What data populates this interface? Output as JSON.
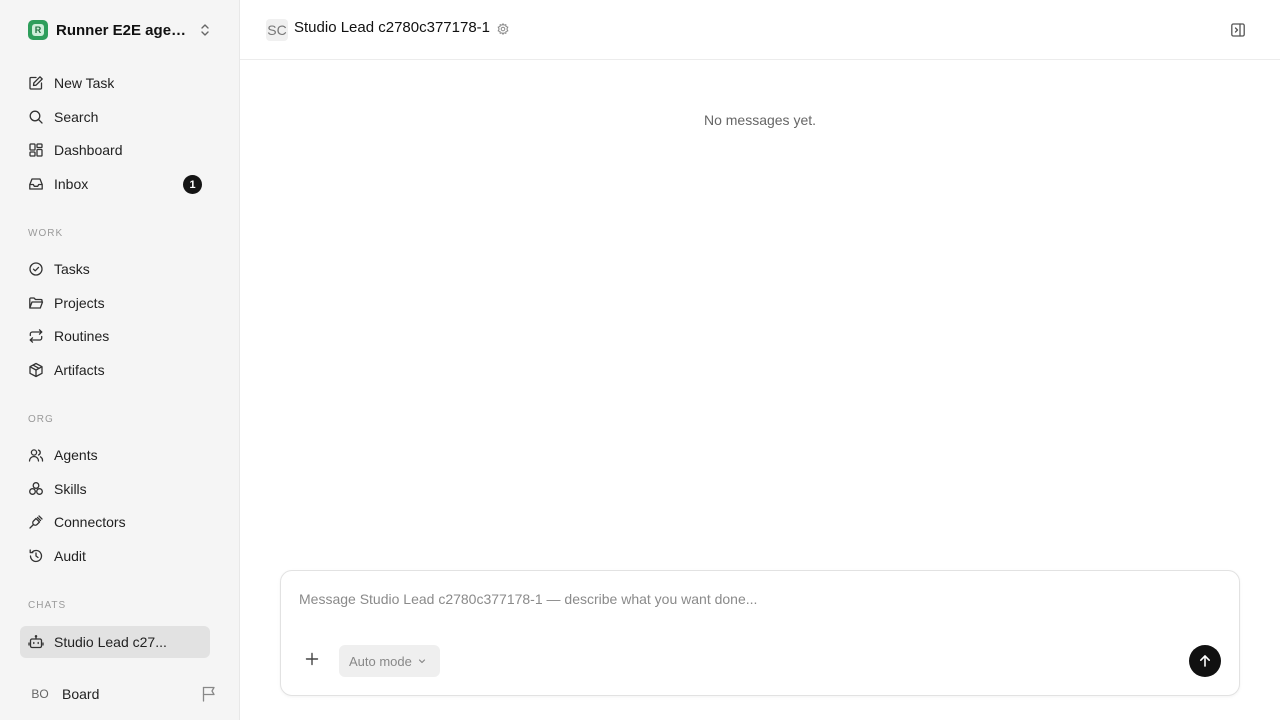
{
  "workspace": {
    "name": "Runner E2E agen...",
    "logo_letter": "R"
  },
  "nav": {
    "new_task": "New Task",
    "search": "Search",
    "dashboard": "Dashboard",
    "inbox": "Inbox",
    "inbox_count": "1"
  },
  "sections": {
    "work": "WORK",
    "org": "ORG",
    "chats": "CHATS"
  },
  "work_items": {
    "tasks": "Tasks",
    "projects": "Projects",
    "routines": "Routines",
    "artifacts": "Artifacts"
  },
  "org_items": {
    "agents": "Agents",
    "skills": "Skills",
    "connectors": "Connectors",
    "audit": "Audit"
  },
  "chats": [
    {
      "label": "Studio Lead c27...",
      "active": true
    }
  ],
  "user": {
    "initials": "BO",
    "name": "Board"
  },
  "header": {
    "avatar_initials": "SC",
    "title": "Studio Lead c2780c377178-1"
  },
  "main": {
    "empty_text": "No messages yet."
  },
  "composer": {
    "placeholder": "Message Studio Lead c2780c377178-1 — describe what you want done...",
    "mode": "Auto mode"
  },
  "colors": {
    "sidebar_bg": "#f5f5f5",
    "active_item_bg": "#e2e2e2",
    "badge_bg": "#141414",
    "logo_green": "#2e9e5b"
  }
}
